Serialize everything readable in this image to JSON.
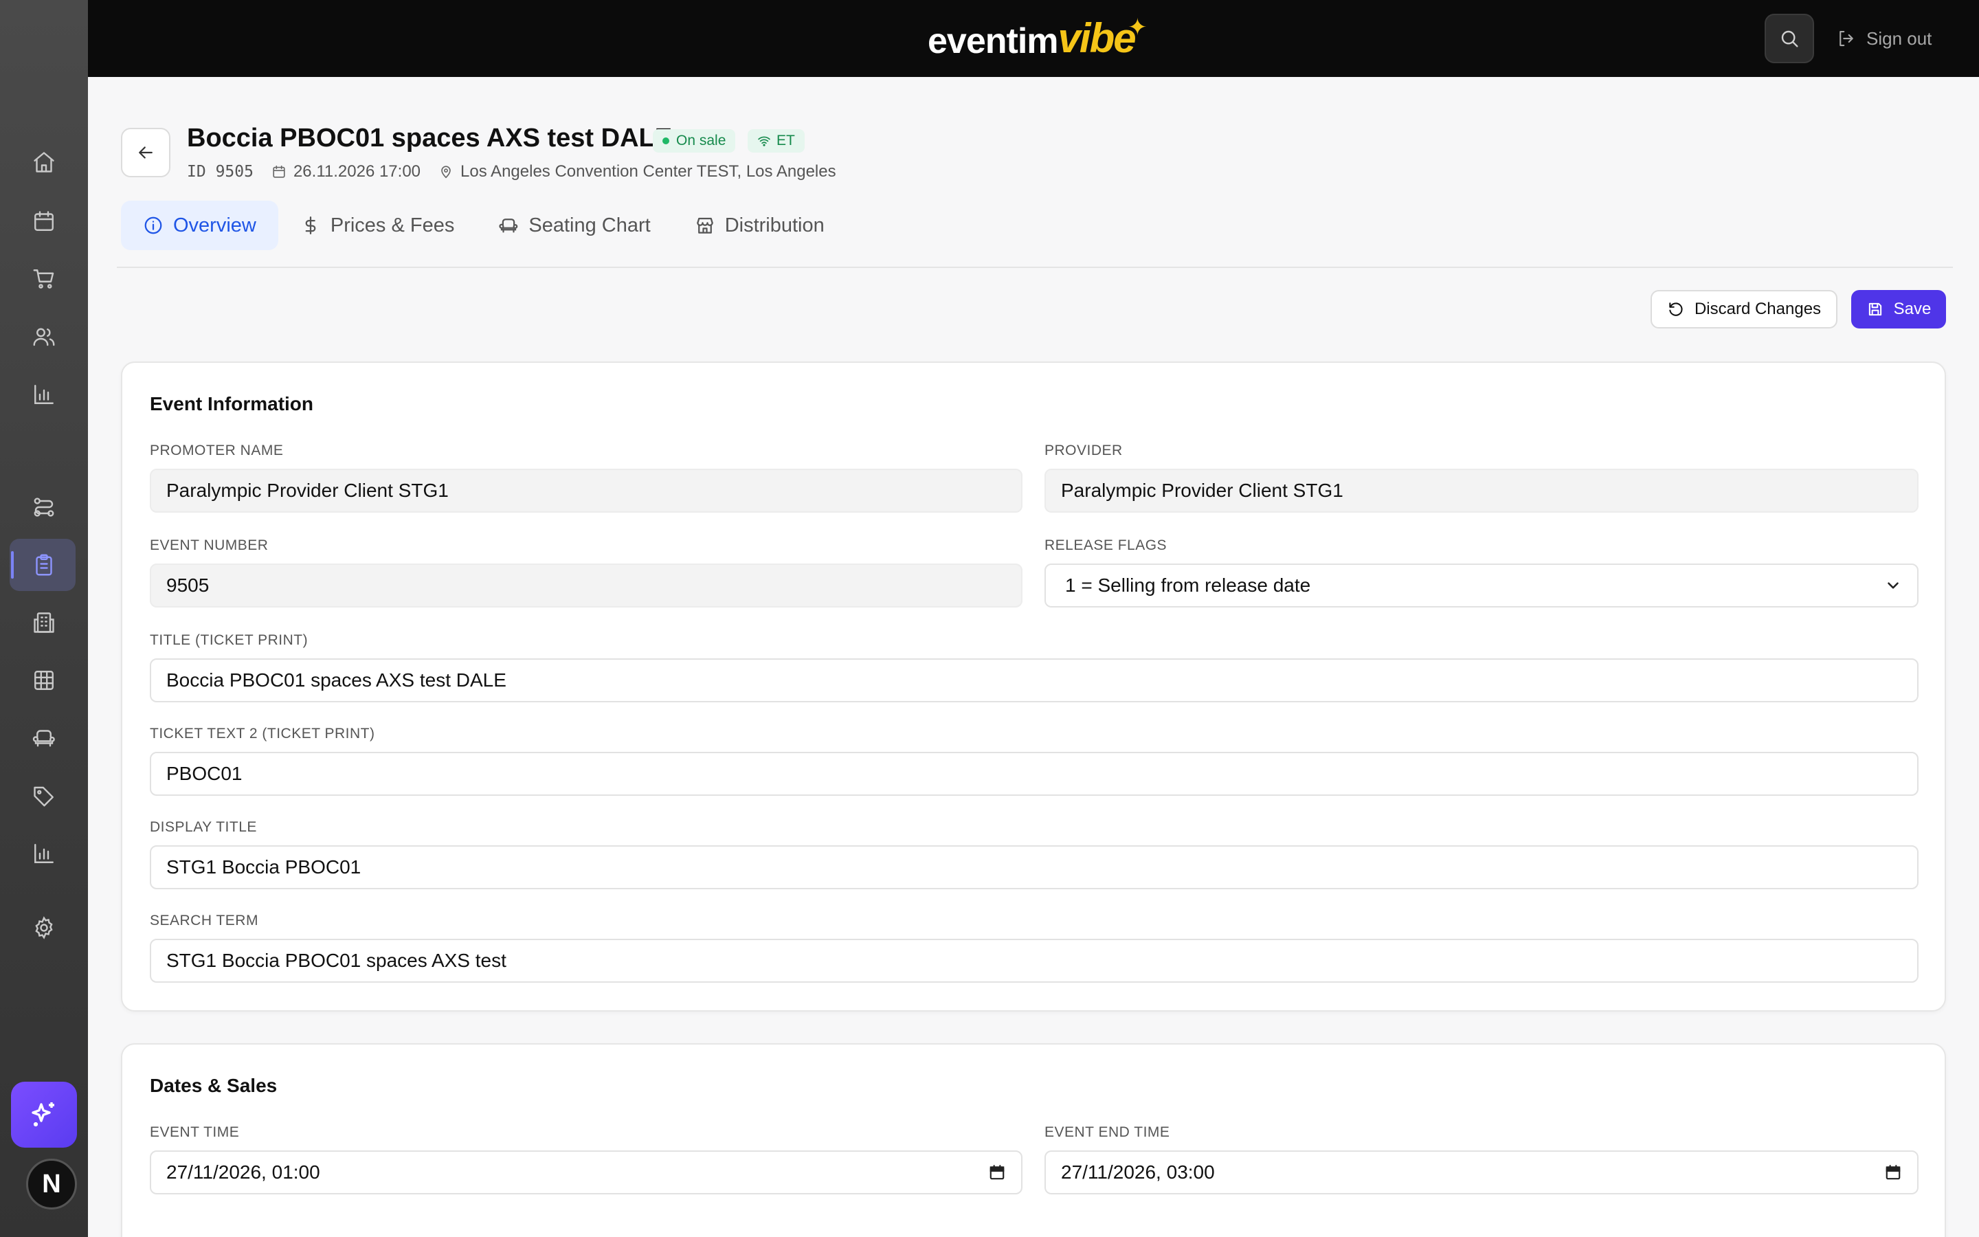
{
  "topbar": {
    "logo_main": "eventim",
    "logo_accent": "vibe",
    "signout_label": "Sign out"
  },
  "sidebar": {
    "items": [
      {
        "icon": "home-icon"
      },
      {
        "icon": "calendar-icon"
      },
      {
        "icon": "cart-icon"
      },
      {
        "icon": "users-icon"
      },
      {
        "icon": "bar-chart-icon"
      },
      {
        "icon": "route-icon"
      },
      {
        "icon": "clipboard-icon",
        "active": true
      },
      {
        "icon": "building-icon"
      },
      {
        "icon": "grid-icon"
      },
      {
        "icon": "armchair-icon"
      },
      {
        "icon": "tag-icon"
      },
      {
        "icon": "bar-chart-icon"
      },
      {
        "icon": "gear-icon"
      }
    ],
    "avatar_letter": "N",
    "accent": "#6b46ff"
  },
  "event": {
    "title": "Boccia PBOC01 spaces AXS test DALE",
    "status": "On sale",
    "channel": "ET",
    "id_label": "ID",
    "id_value": "9505",
    "datetime": "26.11.2026 17:00",
    "venue": "Los Angeles Convention Center TEST, Los Angeles"
  },
  "tabs": [
    {
      "label": "Overview",
      "icon": "info-icon",
      "active": true
    },
    {
      "label": "Prices & Fees",
      "icon": "dollar-icon"
    },
    {
      "label": "Seating Chart",
      "icon": "armchair-icon"
    },
    {
      "label": "Distribution",
      "icon": "store-icon"
    }
  ],
  "actions": {
    "discard_label": "Discard Changes",
    "save_label": "Save",
    "save_color": "#4f35e8"
  },
  "event_information": {
    "title": "Event Information",
    "promoter_name": {
      "label": "PROMOTER NAME",
      "value": "Paralympic Provider Client STG1"
    },
    "provider": {
      "label": "PROVIDER",
      "value": "Paralympic Provider Client STG1"
    },
    "event_number": {
      "label": "EVENT NUMBER",
      "value": "9505"
    },
    "release_flags": {
      "label": "RELEASE FLAGS",
      "value": "1 = Selling from release date"
    },
    "title_ticket_print": {
      "label": "TITLE (TICKET PRINT)",
      "value": "Boccia PBOC01 spaces AXS test DALE"
    },
    "ticket_text_2": {
      "label": "TICKET TEXT 2 (TICKET PRINT)",
      "value": "PBOC01"
    },
    "display_title": {
      "label": "DISPLAY TITLE",
      "value": "STG1 Boccia PBOC01"
    },
    "search_term": {
      "label": "SEARCH TERM",
      "value": "STG1 Boccia PBOC01 spaces AXS test"
    }
  },
  "dates_sales": {
    "title": "Dates & Sales",
    "event_time": {
      "label": "EVENT TIME",
      "value": "27/11/2026, 01:00"
    },
    "event_end_time": {
      "label": "EVENT END TIME",
      "value": "27/11/2026, 03:00"
    }
  }
}
